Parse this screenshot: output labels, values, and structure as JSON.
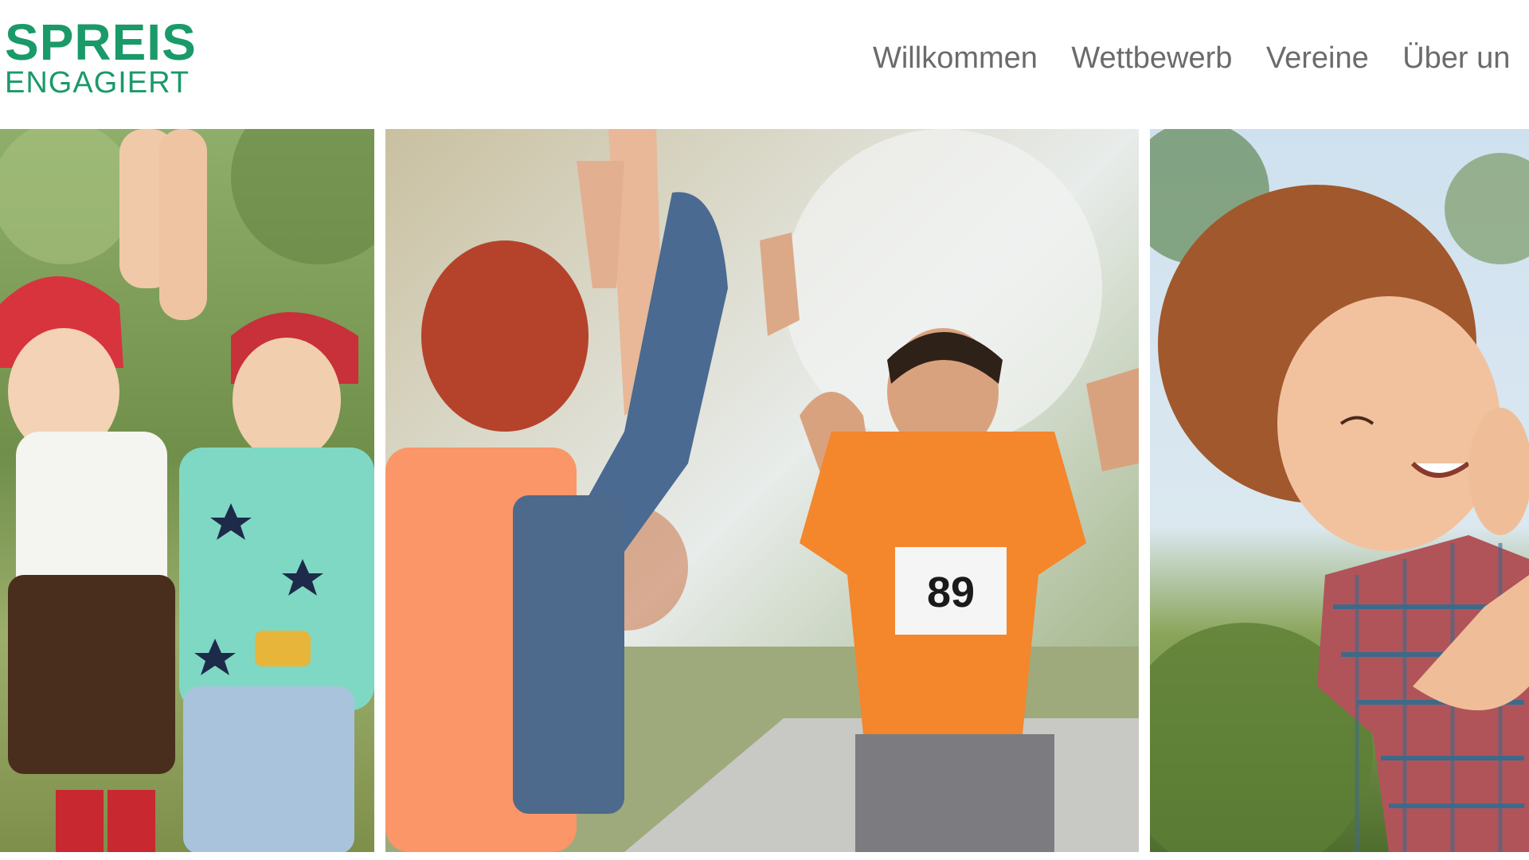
{
  "brand": {
    "line1": "SPREIS",
    "line2": "ENGAGIERT",
    "color": "#1a9a68"
  },
  "nav": {
    "items": [
      {
        "label": "Willkommen"
      },
      {
        "label": "Wettbewerb"
      },
      {
        "label": "Vereine"
      },
      {
        "label": "Über un"
      }
    ],
    "text_color": "#6b6b6b"
  },
  "photos": [
    {
      "subject": "children-cheering"
    },
    {
      "subject": "runner-high-five",
      "bib_number": "89"
    },
    {
      "subject": "smiling-boy"
    }
  ]
}
